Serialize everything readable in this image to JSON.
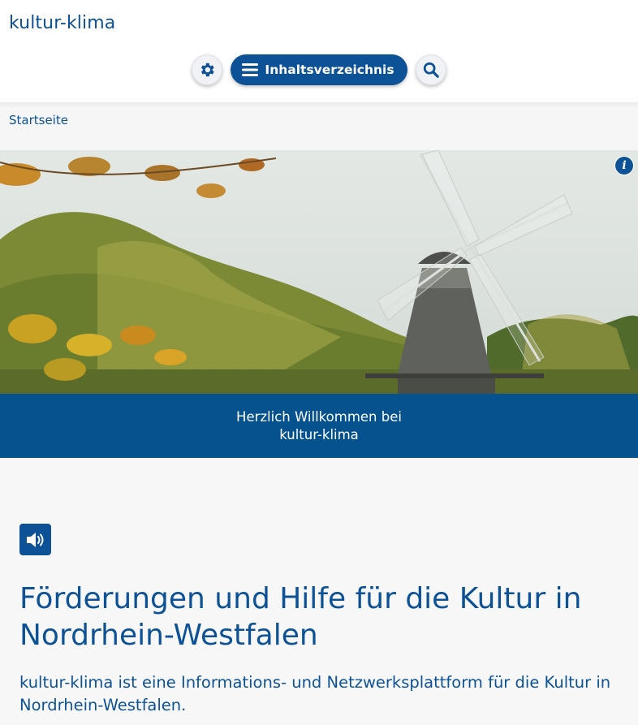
{
  "header": {
    "site_title": "kultur-klima",
    "toc_label": "Inhaltsverzeichnis",
    "icons": {
      "settings": "gear-icon",
      "menu": "hamburger-menu-icon",
      "search": "search-icon"
    }
  },
  "breadcrumb": {
    "items": [
      "Startseite"
    ]
  },
  "hero": {
    "image": "windmill-autumn-landscape",
    "info_label": "i"
  },
  "welcome": {
    "line1": "Herzlich Willkommen bei",
    "line2": "kultur-klima"
  },
  "main": {
    "read_aloud_icon": "speaker-icon",
    "heading": "Förderungen und Hilfe für die Kultur in Nordrhein-Westfalen",
    "intro": "kultur-klima ist eine Informations- und Netzwerksplattform für die Kultur in Nordrhein-Westfalen."
  },
  "colors": {
    "brand_blue": "#0d5296",
    "welcome_band": "#06528f",
    "content_bg": "#f7f7f7"
  }
}
